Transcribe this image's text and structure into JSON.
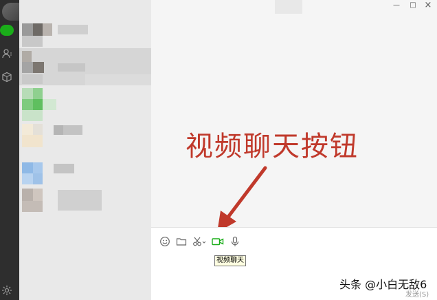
{
  "window": {
    "minimize": "—",
    "maximize": "□",
    "close": "×"
  },
  "sidebar": {
    "icons": [
      "chat-icon",
      "contacts-icon",
      "favorites-cube-icon",
      "settings-gear-icon"
    ]
  },
  "annotation": {
    "text": "视频聊天按钮"
  },
  "toolbar": {
    "icons": [
      "emoji-icon",
      "folder-icon",
      "scissors-icon",
      "video-call-icon",
      "microphone-icon"
    ]
  },
  "tooltip": {
    "text": "视频聊天"
  },
  "watermark": {
    "text": "头条 @小白无敌6"
  },
  "send_button": {
    "label": "发送(S)"
  },
  "colors": {
    "accent_green": "#1aad19",
    "annotation_red": "#c0392b"
  }
}
